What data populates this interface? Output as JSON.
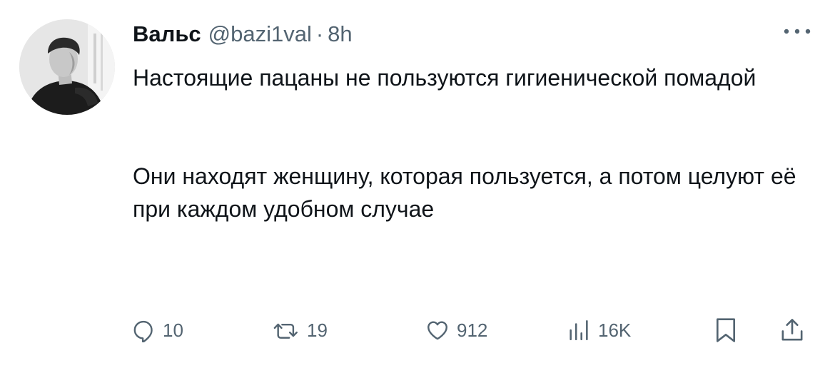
{
  "tweet": {
    "author": {
      "display_name": "Вальс",
      "handle": "@bazi1val",
      "separator": "·",
      "time": "8h",
      "avatar_icon": "person-photo"
    },
    "more_icon": "ellipsis-icon",
    "text_paragraphs": [
      "Настоящие пацаны не пользуются гигиенической помадой",
      "Они находят женщину, которая пользуется, а потом целуют её при каждом удобном случае"
    ],
    "actions": {
      "reply_count": "10",
      "retweet_count": "19",
      "like_count": "912",
      "views_count": "16K"
    },
    "colors": {
      "text_primary": "#0f1419",
      "text_secondary": "#536471",
      "background": "#ffffff"
    }
  }
}
